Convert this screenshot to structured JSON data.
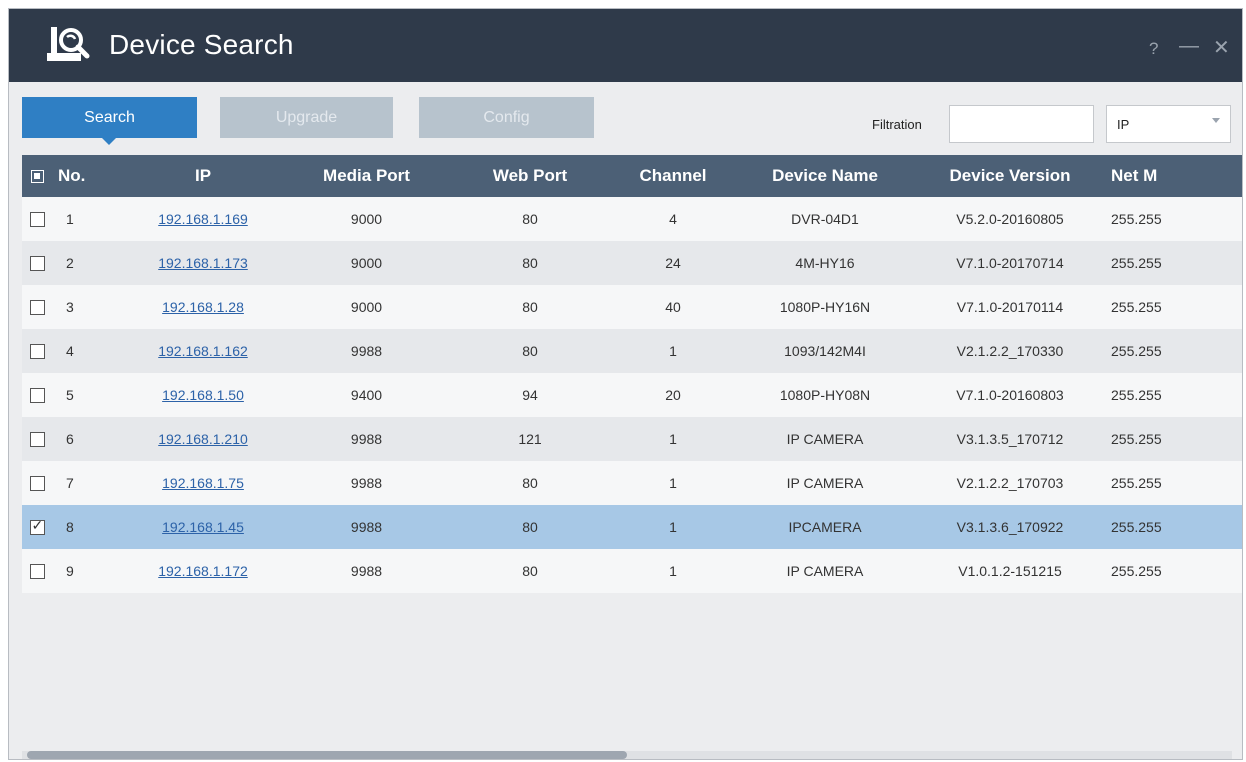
{
  "window": {
    "title": "Device Search",
    "help_icon": "?",
    "minimize_icon": "—",
    "close_icon": "✕"
  },
  "tabs": [
    {
      "label": "Search",
      "active": true
    },
    {
      "label": "Upgrade",
      "active": false
    },
    {
      "label": "Config",
      "active": false
    }
  ],
  "filter": {
    "label": "Filtration",
    "value": "",
    "select_value": "IP"
  },
  "table": {
    "columns": [
      "No.",
      "IP",
      "Media Port",
      "Web Port",
      "Channel",
      "Device Name",
      "Device Version",
      "Net M"
    ],
    "rows": [
      {
        "checked": false,
        "no": "1",
        "ip": "192.168.1.169",
        "media_port": "9000",
        "web_port": "80",
        "channel": "4",
        "device_name": "DVR-04D1",
        "device_version": "V5.2.0-20160805",
        "net_mask": "255.255"
      },
      {
        "checked": false,
        "no": "2",
        "ip": "192.168.1.173",
        "media_port": "9000",
        "web_port": "80",
        "channel": "24",
        "device_name": "4M-HY16",
        "device_version": "V7.1.0-20170714",
        "net_mask": "255.255"
      },
      {
        "checked": false,
        "no": "3",
        "ip": "192.168.1.28",
        "media_port": "9000",
        "web_port": "80",
        "channel": "40",
        "device_name": "1080P-HY16N",
        "device_version": "V7.1.0-20170114",
        "net_mask": "255.255"
      },
      {
        "checked": false,
        "no": "4",
        "ip": "192.168.1.162",
        "media_port": "9988",
        "web_port": "80",
        "channel": "1",
        "device_name": "1093/142M4I",
        "device_version": "V2.1.2.2_170330",
        "net_mask": "255.255"
      },
      {
        "checked": false,
        "no": "5",
        "ip": "192.168.1.50",
        "media_port": "9400",
        "web_port": "94",
        "channel": "20",
        "device_name": "1080P-HY08N",
        "device_version": "V7.1.0-20160803",
        "net_mask": "255.255"
      },
      {
        "checked": false,
        "no": "6",
        "ip": "192.168.1.210",
        "media_port": "9988",
        "web_port": "121",
        "channel": "1",
        "device_name": "IP CAMERA",
        "device_version": "V3.1.3.5_170712",
        "net_mask": "255.255"
      },
      {
        "checked": false,
        "no": "7",
        "ip": "192.168.1.75",
        "media_port": "9988",
        "web_port": "80",
        "channel": "1",
        "device_name": "IP CAMERA",
        "device_version": "V2.1.2.2_170703",
        "net_mask": "255.255"
      },
      {
        "checked": true,
        "no": "8",
        "ip": "192.168.1.45",
        "media_port": "9988",
        "web_port": "80",
        "channel": "1",
        "device_name": "IPCAMERA",
        "device_version": "V3.1.3.6_170922",
        "net_mask": "255.255",
        "selected": true
      },
      {
        "checked": false,
        "no": "9",
        "ip": "192.168.1.172",
        "media_port": "9988",
        "web_port": "80",
        "channel": "1",
        "device_name": "IP CAMERA",
        "device_version": "V1.0.1.2-151215",
        "net_mask": "255.255"
      }
    ]
  },
  "colors": {
    "titlebar": "#2f3a4a",
    "accent": "#2f7fc4",
    "header": "#4c6076",
    "selected_row": "#a7c8e6",
    "link": "#2c62a8"
  }
}
